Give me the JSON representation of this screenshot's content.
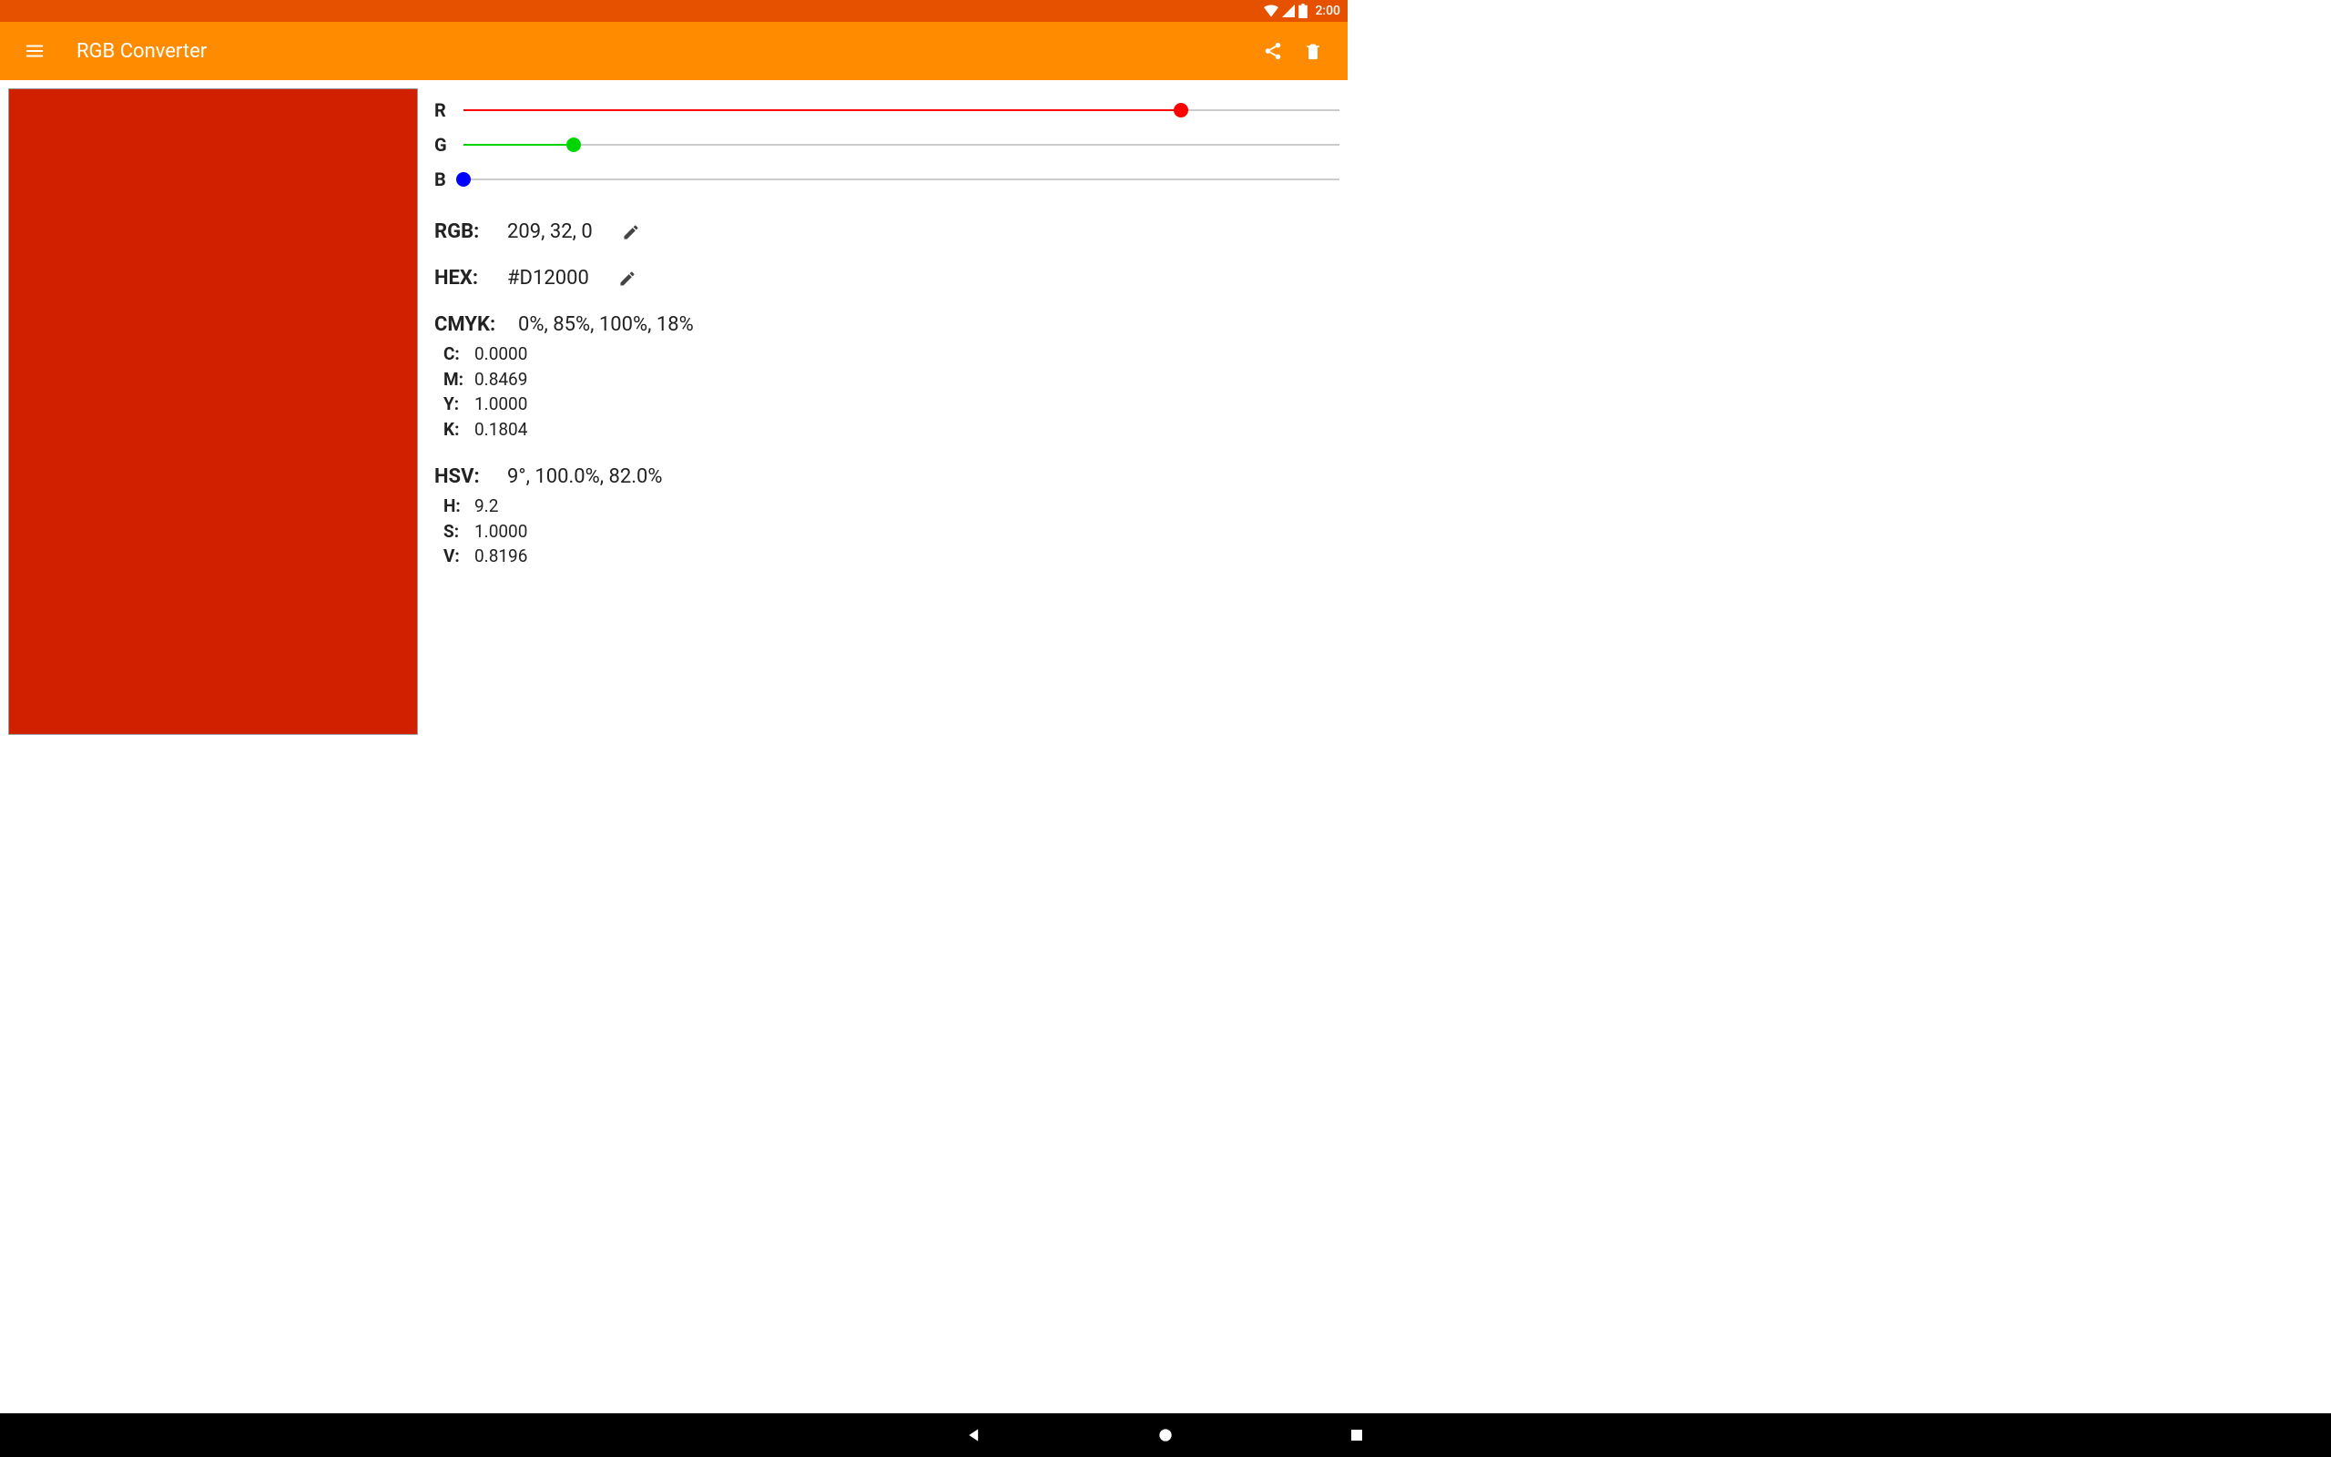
{
  "status": {
    "time": "2:00"
  },
  "appbar": {
    "title": "RGB Converter"
  },
  "color": {
    "hex": "#D12000",
    "r": 209,
    "g": 32,
    "b": 0
  },
  "sliders": {
    "r": {
      "label": "R",
      "percent": 81.96,
      "color": "#ff0000"
    },
    "g": {
      "label": "G",
      "percent": 12.55,
      "color": "#00d500"
    },
    "b": {
      "label": "B",
      "percent": 0,
      "color": "#0000ff"
    }
  },
  "rgb": {
    "label": "RGB:",
    "value": "209, 32, 0"
  },
  "hex": {
    "label": "HEX:",
    "value": "#D12000"
  },
  "cmyk": {
    "label": "CMYK:",
    "value": "0%, 85%, 100%, 18%",
    "details": {
      "c": {
        "label": "C:",
        "value": "0.0000"
      },
      "m": {
        "label": "M:",
        "value": "0.8469"
      },
      "y": {
        "label": "Y:",
        "value": "1.0000"
      },
      "k": {
        "label": "K:",
        "value": "0.1804"
      }
    }
  },
  "hsv": {
    "label": "HSV:",
    "value": "9°, 100.0%, 82.0%",
    "details": {
      "h": {
        "label": "H:",
        "value": "9.2"
      },
      "s": {
        "label": "S:",
        "value": "1.0000"
      },
      "v": {
        "label": "V:",
        "value": "0.8196"
      }
    }
  }
}
